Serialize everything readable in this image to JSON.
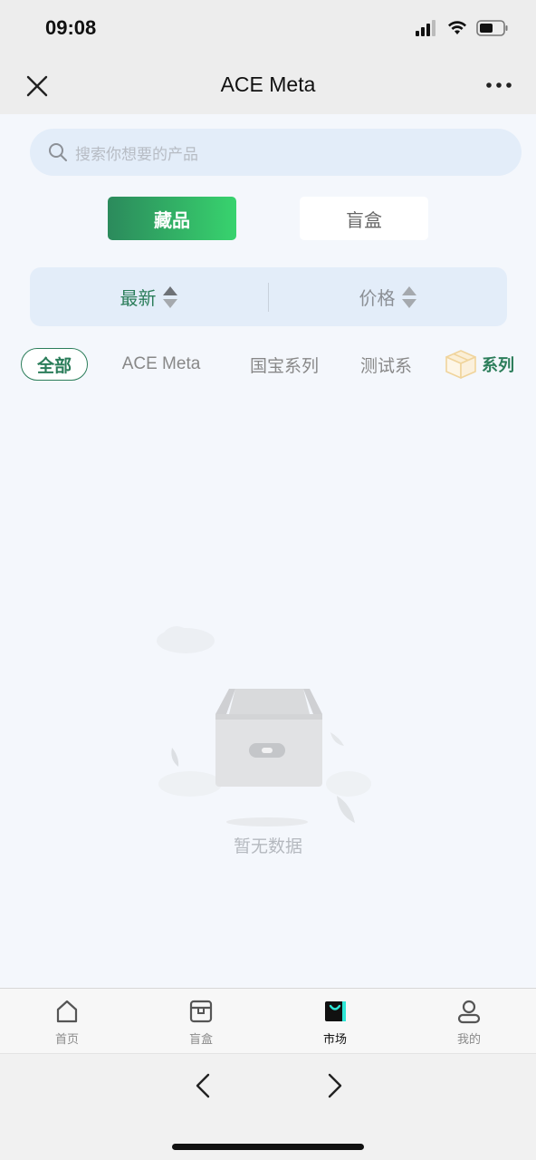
{
  "status_bar": {
    "time": "09:08"
  },
  "nav": {
    "title": "ACE Meta"
  },
  "search": {
    "placeholder": "搜索你想要的产品"
  },
  "segments": {
    "collections": "藏品",
    "blind_box": "盲盒"
  },
  "sort": {
    "latest": "最新",
    "price": "价格"
  },
  "categories": [
    "全部",
    "ACE Meta",
    "国宝系列",
    "测试系"
  ],
  "series_button": {
    "label": "系列"
  },
  "empty": {
    "text": "暂无数据"
  },
  "tabbar": {
    "items": [
      {
        "label": "首页",
        "icon": "home-icon"
      },
      {
        "label": "盲盒",
        "icon": "box-icon"
      },
      {
        "label": "市场",
        "icon": "shopping-bag-icon"
      },
      {
        "label": "我的",
        "icon": "user-icon"
      }
    ],
    "active_index": 2
  },
  "colors": {
    "accent": "#2b7d5a",
    "accent_gradient_end": "#38d36e",
    "panel": "#e3edf9"
  }
}
